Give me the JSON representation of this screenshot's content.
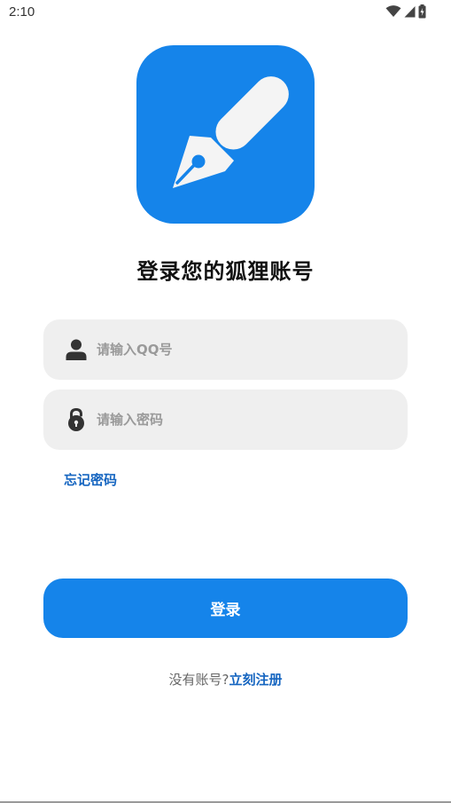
{
  "status_bar": {
    "time": "2:10",
    "icons": [
      "wifi-icon",
      "cellular-signal-icon",
      "battery-icon"
    ]
  },
  "logo": {
    "icon": "fountain-pen-icon",
    "background_color": "#1584ea"
  },
  "title": "登录您的狐狸账号",
  "qq_input": {
    "icon": "user-icon",
    "placeholder": "请输入QQ号",
    "value": ""
  },
  "password_input": {
    "icon": "lock-icon",
    "placeholder": "请输入密码",
    "value": ""
  },
  "forgot_password": "忘记密码",
  "login_button": "登录",
  "register": {
    "prompt": "没有账号?",
    "link": "立刻注册"
  },
  "colors": {
    "accent": "#1584ea",
    "link": "#1565c0",
    "input_background": "#efefef"
  }
}
